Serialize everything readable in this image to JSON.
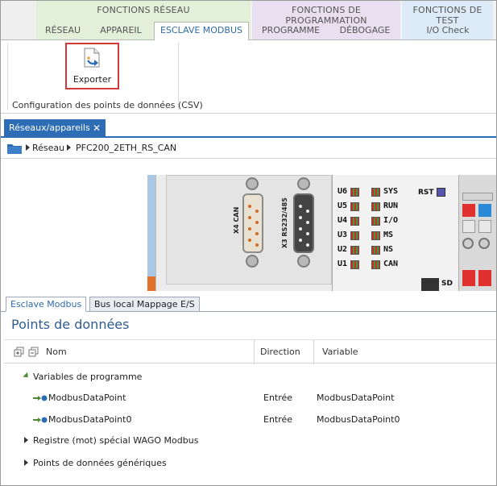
{
  "ribbon": {
    "groups": [
      {
        "title": "FONCTIONS RÉSEAU",
        "tabs": [
          "RÉSEAU",
          "APPAREIL",
          "ESCLAVE MODBUS"
        ],
        "active_tab": "ESCLAVE MODBUS",
        "color": "#e2efd9"
      },
      {
        "title": "FONCTIONS DE PROGRAMMATION",
        "tabs": [
          "PROGRAMME",
          "DÉBOGAGE"
        ],
        "color": "#e8dff0"
      },
      {
        "title": "FONCTIONS DE TEST",
        "tabs": [
          "I/O Check"
        ],
        "color": "#dcebf7"
      }
    ],
    "export_button": {
      "label": "Exporter",
      "icon": "export-document-icon"
    },
    "group_caption": "Configuration des points de données (CSV)"
  },
  "doc_tab": {
    "label": "Réseaux/appareils",
    "close": "✕"
  },
  "breadcrumb": {
    "icon": "folder-icon",
    "items": [
      "Réseau",
      "PFC200_2ETH_RS_CAN"
    ]
  },
  "device": {
    "connectors": [
      "X4 CAN",
      "X3 RS232/485"
    ],
    "leds_left": [
      "U6",
      "U5",
      "U4",
      "U3",
      "U2",
      "U1"
    ],
    "leds_right": [
      "SYS",
      "RUN",
      "I/O",
      "MS",
      "NS",
      "CAN"
    ],
    "reset_label": "RST",
    "sd_label": "SD"
  },
  "lower_tabs": [
    "Esclave Modbus",
    "Bus local Mappage E/S"
  ],
  "lower_active_tab": "Esclave Modbus",
  "section_title": "Points de données",
  "table": {
    "columns": [
      "Nom",
      "Direction",
      "Variable"
    ],
    "groups": [
      {
        "name": "Variables de programme",
        "expanded": true,
        "rows": [
          {
            "name": "ModbusDataPoint",
            "direction": "Entrée",
            "variable": "ModbusDataPoint"
          },
          {
            "name": "ModbusDataPoint0",
            "direction": "Entrée",
            "variable": "ModbusDataPoint0"
          }
        ]
      },
      {
        "name": "Registre (mot) spécial WAGO Modbus",
        "expanded": false
      },
      {
        "name": "Points de données génériques",
        "expanded": false
      }
    ]
  },
  "colors": {
    "accent_blue": "#2d6db5",
    "highlight_red": "#d23a3a",
    "tree_green": "#4b8a34"
  }
}
